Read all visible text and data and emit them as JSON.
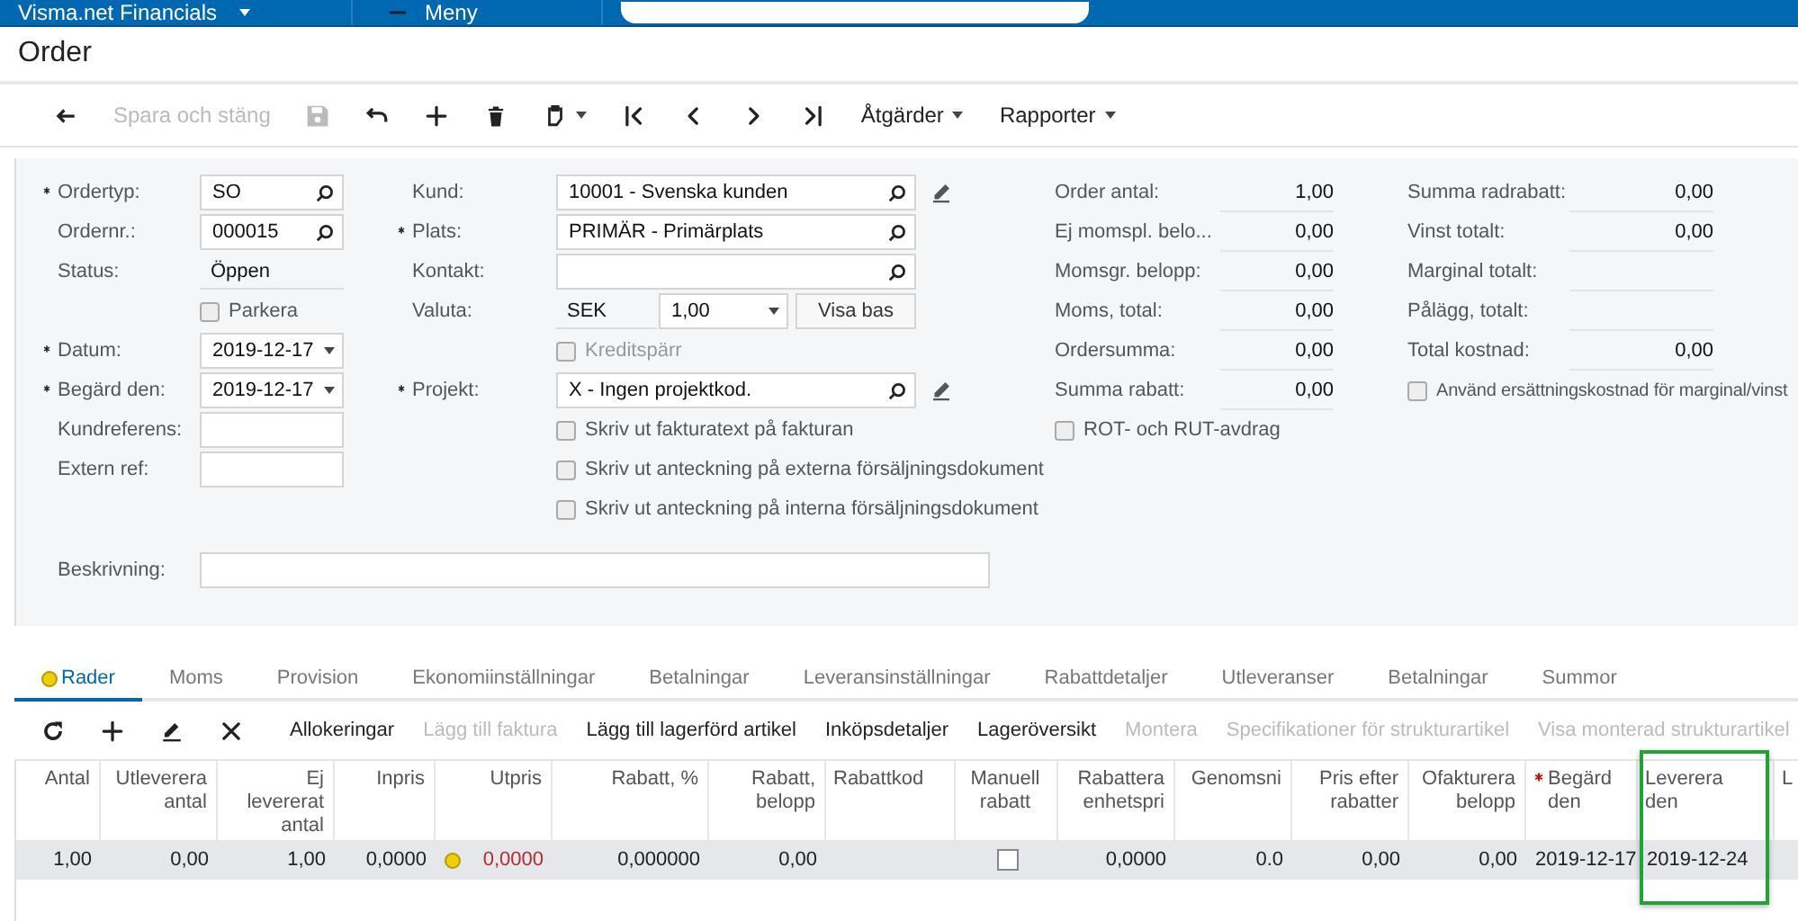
{
  "topbar": {
    "app_name": "Visma.net Financials",
    "menu_label": "Meny"
  },
  "title": "Order",
  "toolbar": {
    "save_and_close": {
      "label": "Spara och stäng",
      "disabled": true
    },
    "save": {
      "disabled": true
    },
    "menus": [
      {
        "label": "Åtgärder"
      },
      {
        "label": "Rapporter"
      }
    ]
  },
  "form": {
    "columns": [
      [
        {
          "kind": "lookup",
          "label": "Ordertyp:",
          "required": true,
          "value": "SO"
        },
        {
          "kind": "lookup",
          "label": "Ordernr.:",
          "required": false,
          "value": "000015"
        },
        {
          "kind": "static",
          "label": "Status:",
          "required": false,
          "value": "Öppen"
        },
        {
          "kind": "checkbox",
          "label": "Parkera",
          "checked": false,
          "disabled": false
        },
        {
          "kind": "date",
          "label": "Datum:",
          "required": true,
          "value": "2019-12-17"
        },
        {
          "kind": "date",
          "label": "Begärd den:",
          "required": true,
          "value": "2019-12-17"
        },
        {
          "kind": "input",
          "label": "Kundreferens:",
          "required": false
        },
        {
          "kind": "input",
          "label": "Extern ref:",
          "required": false
        }
      ],
      [
        {
          "kind": "lookup",
          "label": "Kund:",
          "required": false,
          "value": "10001 - Svenska kunden",
          "edit_button": true
        },
        {
          "kind": "lookup",
          "label": "Plats:",
          "required": true,
          "value": "PRIMÄR - Primärplats",
          "edit_button": false
        },
        {
          "kind": "lookup",
          "label": "Kontakt:",
          "required": false,
          "edit_button": false
        },
        {
          "kind": "currency",
          "label": "Valuta:",
          "required": false,
          "value": "SEK",
          "rate": "1,00",
          "button": "Visa bas"
        },
        {
          "kind": "checkbox",
          "label": "Kreditspärr",
          "checked": false,
          "disabled": true
        },
        {
          "kind": "lookup",
          "label": "Projekt:",
          "required": true,
          "value": "X - Ingen projektkod.",
          "edit_button": true
        },
        {
          "kind": "checkbox",
          "label": "Skriv ut fakturatext på fakturan",
          "checked": false,
          "disabled": false
        },
        {
          "kind": "checkbox",
          "label": "Skriv ut anteckning på externa försäljningsdokument",
          "checked": false,
          "disabled": false
        },
        {
          "kind": "checkbox",
          "label": "Skriv ut anteckning på interna försäljningsdokument",
          "checked": false,
          "disabled": false
        }
      ]
    ],
    "description": {
      "label": "Beskrivning:"
    },
    "summary": [
      [
        {
          "kind": "value",
          "label": "Order antal:",
          "value": "1,00"
        },
        {
          "kind": "value",
          "label": "Ej momspl. belo...",
          "value": "0,00"
        },
        {
          "kind": "value",
          "label": "Momsgr. belopp:",
          "value": "0,00"
        },
        {
          "kind": "value",
          "label": "Moms, total:",
          "value": "0,00"
        },
        {
          "kind": "value",
          "label": "Ordersumma:",
          "value": "0,00"
        },
        {
          "kind": "value",
          "label": "Summa rabatt:",
          "value": "0,00"
        },
        {
          "kind": "checkbox",
          "label": "ROT- och RUT-avdrag",
          "checked": false
        }
      ],
      [
        {
          "kind": "value",
          "label": "Summa radrabatt:",
          "value": "0,00"
        },
        {
          "kind": "value",
          "label": "Vinst totalt:",
          "value": "0,00"
        },
        {
          "kind": "value",
          "label": "Marginal totalt:"
        },
        {
          "kind": "value",
          "label": "Pålägg, totalt:"
        },
        {
          "kind": "value",
          "label": "Total kostnad:",
          "value": "0,00"
        },
        {
          "kind": "checkbox",
          "label": "Använd ersättningskostnad för marginal/vinst",
          "checked": false
        }
      ]
    ]
  },
  "tabs": [
    {
      "label": "Rader",
      "selected": true,
      "warning": true
    },
    {
      "label": "Moms",
      "selected": false,
      "warning": false
    },
    {
      "label": "Provision",
      "selected": false,
      "warning": false
    },
    {
      "label": "Ekonomiinställningar",
      "selected": false,
      "warning": false
    },
    {
      "label": "Betalningar",
      "selected": false,
      "warning": false
    },
    {
      "label": "Leveransinställningar",
      "selected": false,
      "warning": false
    },
    {
      "label": "Rabattdetaljer",
      "selected": false,
      "warning": false
    },
    {
      "label": "Utleveranser",
      "selected": false,
      "warning": false
    },
    {
      "label": "Betalningar",
      "selected": false,
      "warning": false
    },
    {
      "label": "Summor",
      "selected": false,
      "warning": false
    }
  ],
  "grid": {
    "toolbar": [
      {
        "label": "Allokeringar",
        "disabled": false
      },
      {
        "label": "Lägg till faktura",
        "disabled": true
      },
      {
        "label": "Lägg till lagerförd artikel",
        "disabled": false
      },
      {
        "label": "Inköpsdetaljer",
        "disabled": false
      },
      {
        "label": "Lageröversikt",
        "disabled": false
      },
      {
        "label": "Montera",
        "disabled": true
      },
      {
        "label": "Specifikationer för strukturartikel",
        "disabled": true
      },
      {
        "label": "Visa monterad strukturartikel",
        "disabled": true
      }
    ],
    "columns": [
      {
        "label": "Antal",
        "required": false,
        "highlighted": false
      },
      {
        "label": "Utleverera\nantal",
        "required": false,
        "highlighted": false
      },
      {
        "label": "Ej\nlevererat\nantal",
        "required": false,
        "highlighted": false
      },
      {
        "label": "Inpris",
        "required": false,
        "highlighted": false
      },
      {
        "label": "Utpris",
        "required": false,
        "highlighted": false
      },
      {
        "label": "Rabatt, %",
        "required": false,
        "highlighted": false
      },
      {
        "label": "Rabatt,\nbelopp",
        "required": false,
        "highlighted": false
      },
      {
        "label": "Rabattkod",
        "required": false,
        "highlighted": false
      },
      {
        "label": "Manuell\nrabatt",
        "required": false,
        "highlighted": false
      },
      {
        "label": "Rabattera\nenhetspri",
        "required": false,
        "highlighted": false
      },
      {
        "label": "Genomsni",
        "required": false,
        "highlighted": false
      },
      {
        "label": "Pris efter\nrabatter",
        "required": false,
        "highlighted": false
      },
      {
        "label": "Ofakturera\nbelopp",
        "required": false,
        "highlighted": false
      },
      {
        "label": "Begärd\nden",
        "required": true,
        "highlighted": false
      },
      {
        "label": "Leverera\nden",
        "required": false,
        "highlighted": true
      },
      {
        "label": "L",
        "required": false,
        "highlighted": false
      }
    ],
    "rows": [
      {
        "selected": true,
        "cells": [
          {
            "kind": "text",
            "value": "1,00"
          },
          {
            "kind": "text",
            "value": "0,00"
          },
          {
            "kind": "text",
            "value": "1,00"
          },
          {
            "kind": "text",
            "value": "0,0000"
          },
          {
            "kind": "text",
            "value": "0,0000",
            "warning": true,
            "error": true
          },
          {
            "kind": "text",
            "value": "0,000000"
          },
          {
            "kind": "text",
            "value": "0,00"
          },
          {
            "kind": "text"
          },
          {
            "kind": "checkbox",
            "checked": false
          },
          {
            "kind": "text",
            "value": "0,0000"
          },
          {
            "kind": "text",
            "value": "0.0"
          },
          {
            "kind": "text",
            "value": "0,00"
          },
          {
            "kind": "text",
            "value": "0,00"
          },
          {
            "kind": "text",
            "value": "2019-12-17"
          },
          {
            "kind": "text",
            "value": "2019-12-24"
          },
          {
            "kind": "text"
          }
        ]
      }
    ]
  }
}
